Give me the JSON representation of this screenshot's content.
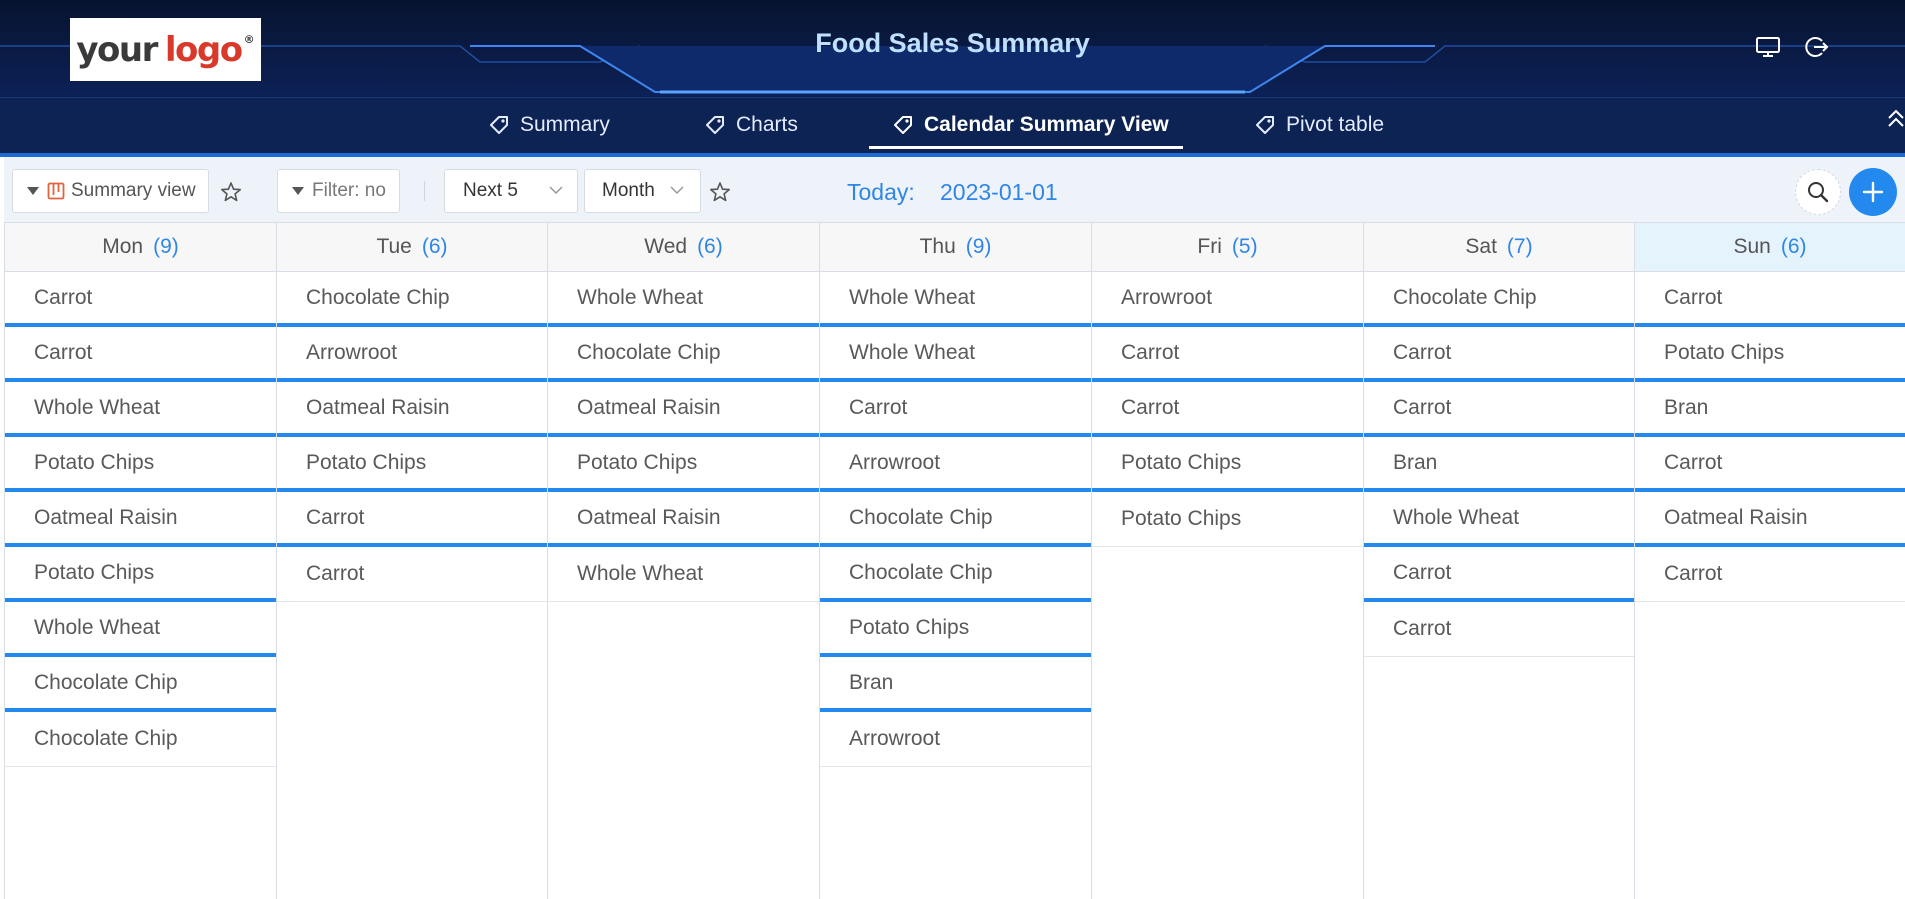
{
  "header": {
    "logo": {
      "word1": "your",
      "word2": "logo",
      "mark": "®"
    },
    "title": "Food Sales Summary",
    "icons": [
      "monitor-icon",
      "logout-icon"
    ]
  },
  "nav": {
    "tabs": [
      {
        "label": "Summary",
        "icon": "tag-icon",
        "active": false
      },
      {
        "label": "Charts",
        "icon": "tag-icon",
        "active": false
      },
      {
        "label": "Calendar Summary View",
        "icon": "tag-icon",
        "active": true
      },
      {
        "label": "Pivot table",
        "icon": "tag-icon",
        "active": false
      }
    ]
  },
  "toolbar": {
    "view_label": "Summary view",
    "filter_label": "Filter: no",
    "range_label": "Next 5",
    "period_label": "Month",
    "today_label": "Today:",
    "today_value": "2023-01-01"
  },
  "calendar": {
    "days": [
      {
        "name": "Mon",
        "count": "(9)",
        "items": [
          "Carrot",
          "Carrot",
          "Whole Wheat",
          "Potato Chips",
          "Oatmeal Raisin",
          "Potato Chips",
          "Whole Wheat",
          "Chocolate Chip",
          "Chocolate Chip"
        ]
      },
      {
        "name": "Tue",
        "count": "(6)",
        "items": [
          "Chocolate Chip",
          "Arrowroot",
          "Oatmeal Raisin",
          "Potato Chips",
          "Carrot",
          "Carrot"
        ]
      },
      {
        "name": "Wed",
        "count": "(6)",
        "items": [
          "Whole Wheat",
          "Chocolate Chip",
          "Oatmeal Raisin",
          "Potato Chips",
          "Oatmeal Raisin",
          "Whole Wheat"
        ]
      },
      {
        "name": "Thu",
        "count": "(9)",
        "items": [
          "Whole Wheat",
          "Whole Wheat",
          "Carrot",
          "Arrowroot",
          "Chocolate Chip",
          "Chocolate Chip",
          "Potato Chips",
          "Bran",
          "Arrowroot"
        ]
      },
      {
        "name": "Fri",
        "count": "(5)",
        "items": [
          "Arrowroot",
          "Carrot",
          "Carrot",
          "Potato Chips",
          "Potato Chips"
        ]
      },
      {
        "name": "Sat",
        "count": "(7)",
        "items": [
          "Chocolate Chip",
          "Carrot",
          "Carrot",
          "Bran",
          "Whole Wheat",
          "Carrot",
          "Carrot"
        ]
      },
      {
        "name": "Sun",
        "count": "(6)",
        "items": [
          "Carrot",
          "Potato Chips",
          "Bran",
          "Carrot",
          "Oatmeal Raisin",
          "Carrot"
        ]
      }
    ]
  },
  "colors": {
    "accent": "#2389ee",
    "header_bg": "#0b1f4f",
    "title": "#bfe0ff"
  }
}
